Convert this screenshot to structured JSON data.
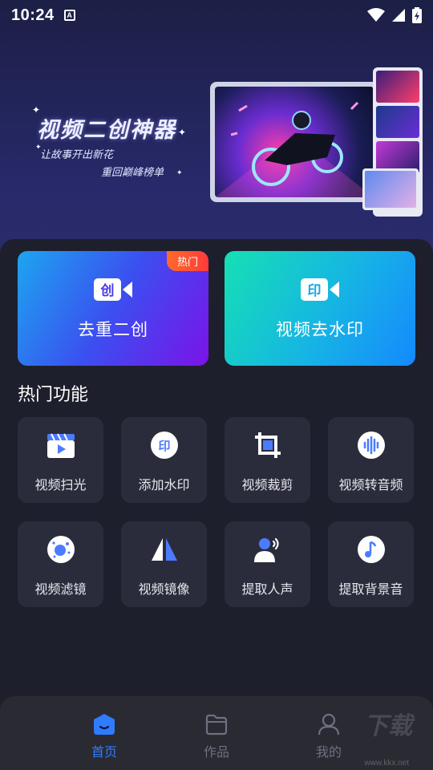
{
  "status_bar": {
    "time": "10:24",
    "notification_icon": "A"
  },
  "banner": {
    "title": "视频二创神器",
    "subtitle_line1": "让故事开出新花",
    "subtitle_line2": "重回巅峰榜单"
  },
  "cards": [
    {
      "label": "去重二创",
      "icon_text": "创",
      "badge": "热门"
    },
    {
      "label": "视频去水印",
      "icon_text": "印"
    }
  ],
  "section_title": "热门功能",
  "tools": [
    {
      "label": "视频扫光",
      "icon": "clapperboard-icon"
    },
    {
      "label": "添加水印",
      "icon": "watermark-icon"
    },
    {
      "label": "视频裁剪",
      "icon": "crop-icon"
    },
    {
      "label": "视频转音频",
      "icon": "audio-wave-icon"
    },
    {
      "label": "视频滤镜",
      "icon": "filter-icon"
    },
    {
      "label": "视频镜像",
      "icon": "mirror-icon"
    },
    {
      "label": "提取人声",
      "icon": "voice-icon"
    },
    {
      "label": "提取背景音",
      "icon": "music-note-icon"
    }
  ],
  "nav": [
    {
      "label": "首页",
      "active": true
    },
    {
      "label": "作品",
      "active": false
    },
    {
      "label": "我的",
      "active": false
    }
  ],
  "watermark": {
    "logo": "下载",
    "url": "www.kkx.net"
  },
  "colors": {
    "accent": "#2f7cff",
    "panel": "#1e1f2c",
    "tile": "#2b2c3b"
  }
}
